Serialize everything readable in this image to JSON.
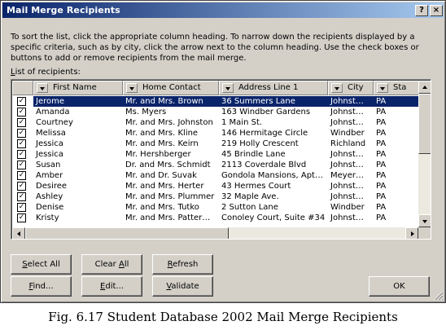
{
  "window": {
    "title": "Mail Merge Recipients",
    "help_label": "?",
    "close_label": "×"
  },
  "instructions": "To sort the list, click the appropriate column heading.  To narrow down the recipients displayed by a specific criteria, such as by city, click the arrow next to the column heading.  Use the check boxes or buttons to add or remove recipients from the mail merge.",
  "list_label": {
    "first_char": "L",
    "rest": "ist of recipients:"
  },
  "columns": [
    "First Name",
    "Home Contact",
    "Address Line 1",
    "City",
    "Sta"
  ],
  "rows": [
    {
      "checked": "✓",
      "first": "Jerome",
      "contact": "Mr. and Mrs. Brown",
      "address": "36 Summers Lane",
      "city": "Johnst…",
      "state": "PA",
      "selected": true
    },
    {
      "checked": "✓",
      "first": "Amanda",
      "contact": "Ms. Myers",
      "address": "163 Windber Gardens",
      "city": "Johnst…",
      "state": "PA"
    },
    {
      "checked": "✓",
      "first": "Courtney",
      "contact": "Mr. and Mrs. Johnston",
      "address": "1 Main St.",
      "city": "Johnst…",
      "state": "PA"
    },
    {
      "checked": "✓",
      "first": "Melissa",
      "contact": "Mr. and Mrs. Kline",
      "address": "146 Hermitage Circle",
      "city": "Windber",
      "state": "PA"
    },
    {
      "checked": "✓",
      "first": "Jessica",
      "contact": "Mr. and Mrs. Keirn",
      "address": "219 Holly Crescent",
      "city": "Richland",
      "state": "PA"
    },
    {
      "checked": "✓",
      "first": "Jessica",
      "contact": "Mr. Hershberger",
      "address": "45 Brindle Lane",
      "city": "Johnst…",
      "state": "PA"
    },
    {
      "checked": "✓",
      "first": "Susan",
      "contact": "Dr. and Mrs. Schmidt",
      "address": "2113 Coverdale Blvd",
      "city": "Johnst…",
      "state": "PA"
    },
    {
      "checked": "✓",
      "first": "Amber",
      "contact": "Mr. and Dr. Suvak",
      "address": "Gondola Mansions, Apt…",
      "city": "Meyer…",
      "state": "PA"
    },
    {
      "checked": "✓",
      "first": "Desiree",
      "contact": "Mr. and Mrs. Herter",
      "address": "43 Hermes Court",
      "city": "Johnst…",
      "state": "PA"
    },
    {
      "checked": "✓",
      "first": "Ashley",
      "contact": "Mr. and Mrs. Plummer",
      "address": "32 Maple Ave.",
      "city": "Johnst…",
      "state": "PA"
    },
    {
      "checked": "✓",
      "first": "Denise",
      "contact": "Mr. and Mrs. Tutko",
      "address": "2 Sutton Lane",
      "city": "Windber",
      "state": "PA"
    },
    {
      "checked": "✓",
      "first": "Kristy",
      "contact": "Mr. and Mrs. Patter…",
      "address": "Conoley Court, Suite #34",
      "city": "Johnst…",
      "state": "PA"
    }
  ],
  "buttons": {
    "select_all": {
      "key": "S",
      "rest": "elect All"
    },
    "clear_all": {
      "pre": "Clear ",
      "key": "A",
      "rest": "ll"
    },
    "refresh": {
      "key": "R",
      "rest": "efresh"
    },
    "find": {
      "key": "F",
      "rest": "ind..."
    },
    "edit": {
      "key": "E",
      "rest": "dit..."
    },
    "validate": {
      "key": "V",
      "rest": "alidate"
    },
    "ok": "OK"
  },
  "caption": "Fig. 6.17 Student Database 2002 Mail Merge Recipients",
  "colors": {
    "selection": "#0a246a",
    "dialog_face": "#d4d0c8"
  }
}
